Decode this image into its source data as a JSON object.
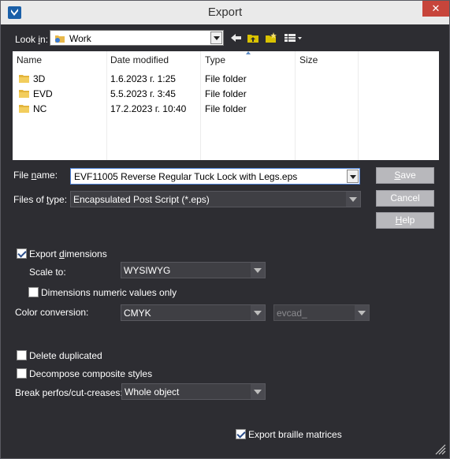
{
  "window": {
    "title": "Export",
    "close_glyph": "✕"
  },
  "lookin": {
    "label_pre": "Look ",
    "label_u": "i",
    "label_post": "n:",
    "value": "Work"
  },
  "toolbar": {
    "icons": [
      "back-arrow-icon",
      "up-folder-icon",
      "new-folder-icon",
      "view-menu-icon"
    ]
  },
  "file_list": {
    "columns": [
      "Name",
      "Date modified",
      "Type",
      "Size"
    ],
    "rows": [
      {
        "name": "3D",
        "date": "1.6.2023 г. 1:25",
        "type": "File folder",
        "size": ""
      },
      {
        "name": "EVD",
        "date": "5.5.2023 г. 3:45",
        "type": "File folder",
        "size": ""
      },
      {
        "name": "NC",
        "date": "17.2.2023 г. 10:40",
        "type": "File folder",
        "size": ""
      }
    ]
  },
  "file_name": {
    "label_pre": "File ",
    "label_u": "n",
    "label_post": "ame:",
    "value": "EVF11005 Reverse Regular Tuck Lock with Legs.eps"
  },
  "file_type": {
    "label_pre": "Files of ",
    "label_u": "t",
    "label_post": "ype:",
    "value": "Encapsulated Post Script (*.eps)"
  },
  "buttons": {
    "save_pre": "",
    "save_u": "S",
    "save_post": "ave",
    "cancel": "Cancel",
    "help_pre": "",
    "help_u": "H",
    "help_post": "elp"
  },
  "options": {
    "export_dimensions_pre": "Export ",
    "export_dimensions_u": "d",
    "export_dimensions_post": "imensions",
    "export_dimensions_checked": true,
    "scale_to_label": "Scale to:",
    "scale_to_value": "WYSIWYG",
    "dimensions_numeric_label": "Dimensions numeric values only",
    "dimensions_numeric_checked": false,
    "color_conversion_label": "Color conversion:",
    "color_conversion_value": "CMYK",
    "color_profile_value": "evcad_",
    "delete_duplicated_label": "Delete duplicated",
    "delete_duplicated_checked": false,
    "decompose_label": "Decompose composite styles",
    "decompose_checked": false,
    "break_perfos_label": "Break perfos/cut-creases:",
    "break_perfos_value": "Whole object",
    "export_braille_label": "Export braille matrices",
    "export_braille_checked": true
  },
  "colors": {
    "background": "#2d2d32",
    "titlebar": "#eaeaea",
    "close": "#c7453b",
    "button": "#b8b8bc",
    "selection_border": "#4b7fd6"
  }
}
